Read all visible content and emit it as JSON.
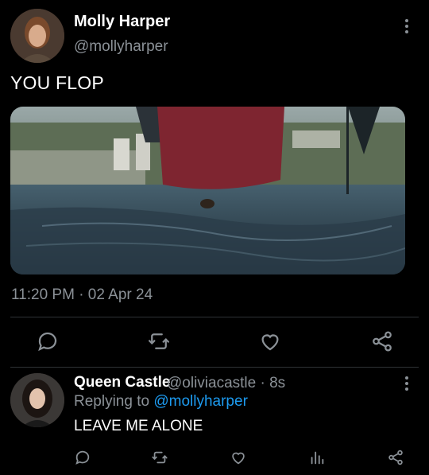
{
  "main_tweet": {
    "author_name": "Molly Harper",
    "author_handle": "@mollyharper",
    "text": "YOU FLOP",
    "timestamp": "11:20 PM · 02 Apr 24",
    "media_description_icon": "video-still-image"
  },
  "main_actions": [
    {
      "icon": "comment-icon"
    },
    {
      "icon": "retweet-icon"
    },
    {
      "icon": "heart-icon"
    },
    {
      "icon": "share-icon"
    }
  ],
  "reply": {
    "author_name": "Queen Castle",
    "author_handle_time": "@oliviacastle · 8s",
    "replying_prefix": "Replying to ",
    "replying_mention": "@mollyharper",
    "text": "LEAVE ME ALONE"
  },
  "reply_actions": [
    {
      "icon": "comment-icon"
    },
    {
      "icon": "retweet-icon"
    },
    {
      "icon": "heart-icon"
    },
    {
      "icon": "stats-icon"
    },
    {
      "icon": "share-icon"
    }
  ],
  "colors": {
    "background": "#000000",
    "text": "#ffffff",
    "muted": "#8b9197",
    "link": "#1d9bf0",
    "divider": "#2f3336"
  }
}
